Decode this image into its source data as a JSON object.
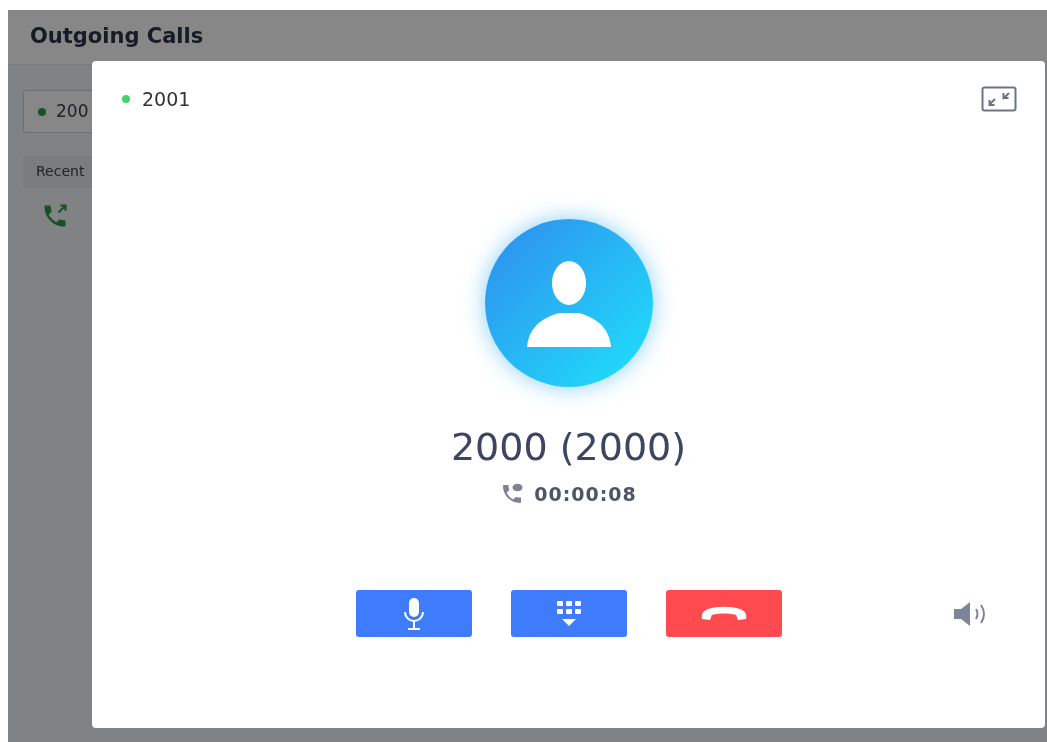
{
  "page": {
    "title": "Outgoing Calls",
    "account": {
      "label": "200",
      "online": true
    },
    "recent_tab": "Recent"
  },
  "dialog": {
    "account": {
      "label": "2001",
      "online": true
    },
    "caller": "2000 (2000)",
    "duration": "00:00:08",
    "controls": [
      {
        "kind": "mic"
      },
      {
        "kind": "dialpad"
      },
      {
        "kind": "hangup"
      }
    ]
  }
}
